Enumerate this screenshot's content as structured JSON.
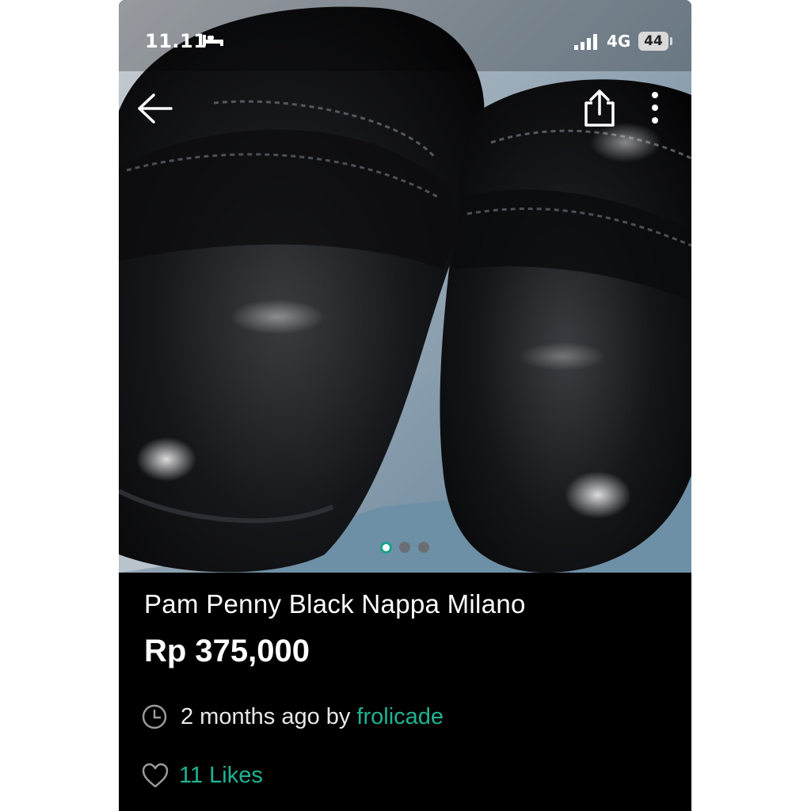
{
  "status_bar": {
    "time": "11.11",
    "network": "4G",
    "battery": "44"
  },
  "icons": {
    "back": "back-arrow-icon",
    "share": "share-icon",
    "more": "more-vertical-icon",
    "clock": "clock-icon",
    "heart": "heart-icon",
    "bed": "bed-icon",
    "signal": "signal-icon"
  },
  "gallery": {
    "image_alt": "Black leather penny loafers",
    "page_count": 3,
    "current_page": 1
  },
  "listing": {
    "title": "Pam Penny Black Nappa Milano",
    "price": "Rp 375,000",
    "posted": "2 months ago by",
    "seller": "frolicade",
    "likes": "11 Likes"
  },
  "colors": {
    "accent": "#1fb394",
    "background": "#000000",
    "text": "#ffffff"
  }
}
